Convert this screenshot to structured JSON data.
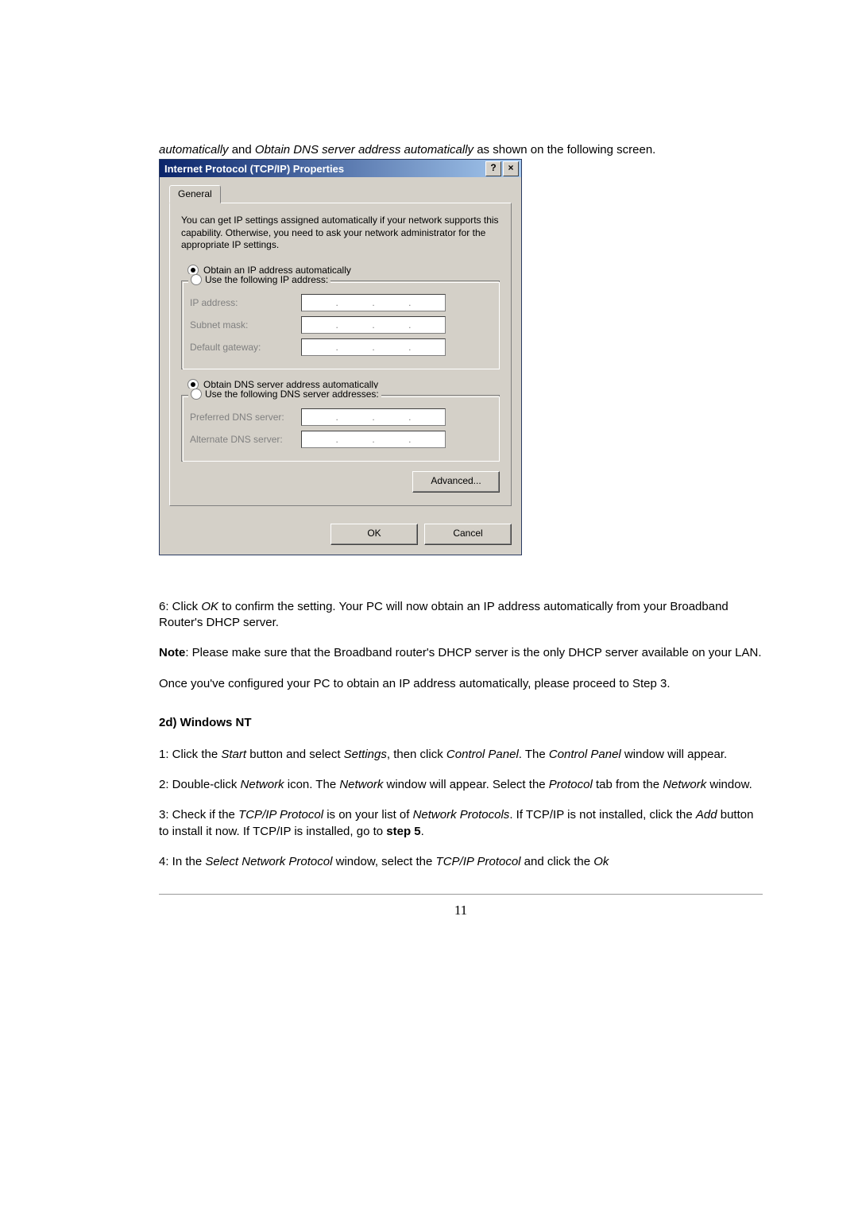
{
  "intro": {
    "pre": "automatically",
    "mid": " and ",
    "em2": "Obtain DNS server address automatically",
    "post": " as shown on the following screen."
  },
  "dialog": {
    "title": "Internet Protocol (TCP/IP) Properties",
    "help_btn": "?",
    "close_btn": "×",
    "tab": "General",
    "description": "You can get IP settings assigned automatically if your network supports this capability. Otherwise, you need to ask your network administrator for the appropriate IP settings.",
    "radio_ip_auto": "Obtain an IP address automatically",
    "radio_ip_manual": "Use the following IP address:",
    "ip_address_label": "IP address:",
    "subnet_label": "Subnet mask:",
    "gateway_label": "Default gateway:",
    "radio_dns_auto": "Obtain DNS server address automatically",
    "radio_dns_manual": "Use the following DNS server addresses:",
    "pref_dns_label": "Preferred DNS server:",
    "alt_dns_label": "Alternate DNS server:",
    "advanced_btn": "Advanced...",
    "ok_btn": "OK",
    "cancel_btn": "Cancel"
  },
  "body": {
    "step6_a": "6: Click ",
    "step6_em": "OK",
    "step6_b": " to confirm the setting. Your PC will now obtain an IP address automatically from your Broadband Router's DHCP server.",
    "note_label": "Note",
    "note_text": ": Please make sure that the Broadband router's DHCP server is the only DHCP server available on your LAN.",
    "once": "Once you've configured your PC to obtain an IP address automatically, please proceed to Step 3.",
    "section": "2d) Windows NT",
    "s1_a": "1: Click the ",
    "s1_em1": "Start",
    "s1_b": " button and select ",
    "s1_em2": "Settings",
    "s1_c": ", then click ",
    "s1_em3": "Control Panel",
    "s1_d": ". The ",
    "s1_em4": "Control Panel",
    "s1_e": " window will appear.",
    "s2_a": "2: Double-click ",
    "s2_em1": "Network",
    "s2_b": " icon. The ",
    "s2_em2": "Network",
    "s2_c": " window will appear. Select the ",
    "s2_em3": "Protocol",
    "s2_d": " tab from the ",
    "s2_em4": "Network",
    "s2_e": " window.",
    "s3_a": "3: Check if the ",
    "s3_em1": "TCP/IP Protocol",
    "s3_b": " is on your list of ",
    "s3_em2": "Network Protocols",
    "s3_c": ". If TCP/IP is not installed, click the ",
    "s3_em3": "Add",
    "s3_d": " button to install it now. If TCP/IP is installed, go to ",
    "s3_strong": "step 5",
    "s3_e": ".",
    "s4_a": "4: In the ",
    "s4_em1": "Select Network Protocol",
    "s4_b": " window, select the ",
    "s4_em2": "TCP/IP Protocol",
    "s4_c": " and click the ",
    "s4_em3": "Ok",
    "page_number": "11"
  }
}
